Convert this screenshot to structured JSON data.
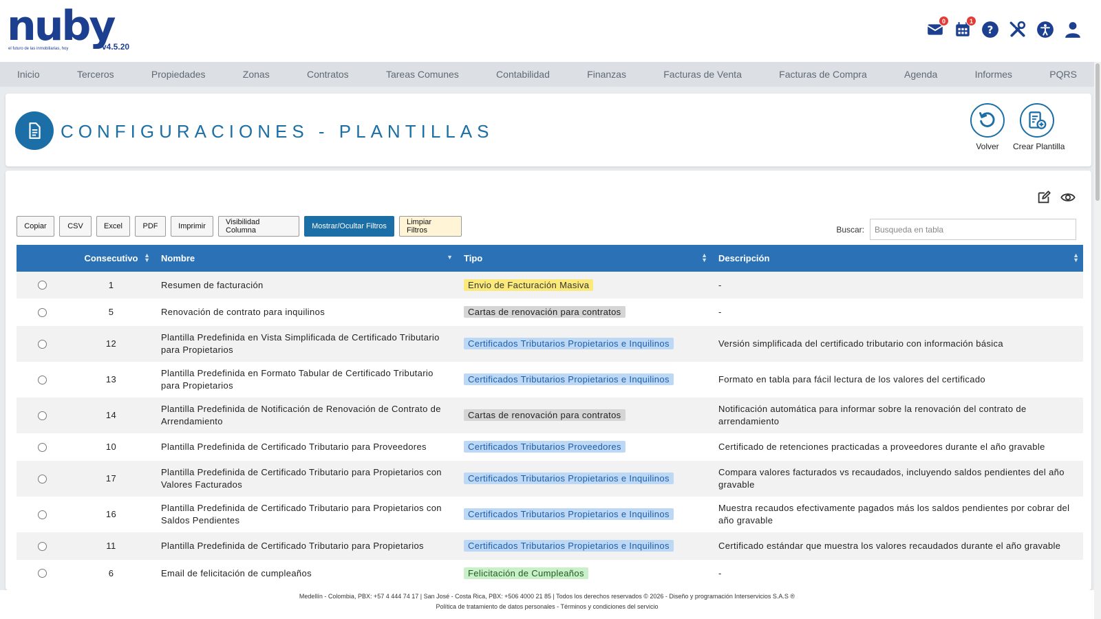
{
  "brand": {
    "name": "nuby",
    "tagline": "el futuro de las inmobiliarias, hoy",
    "version": "v4.5.20",
    "color": "#1d3f8f"
  },
  "header_icons": [
    {
      "name": "mail-icon",
      "badge": "0"
    },
    {
      "name": "calendar-icon",
      "badge": "1"
    },
    {
      "name": "help-icon",
      "badge": ""
    },
    {
      "name": "tools-icon",
      "badge": ""
    },
    {
      "name": "accessibility-icon",
      "badge": ""
    },
    {
      "name": "user-icon",
      "badge": ""
    }
  ],
  "nav": [
    "Inicio",
    "Terceros",
    "Propiedades",
    "Zonas",
    "Contratos",
    "Tareas Comunes",
    "Contabilidad",
    "Finanzas",
    "Facturas de Venta",
    "Facturas de Compra",
    "Agenda",
    "Informes",
    "PQRS"
  ],
  "page": {
    "title": "CONFIGURACIONES - PLANTILLAS",
    "accent": "#1b6fa6",
    "actions": {
      "back": "Volver",
      "create": "Crear Plantilla"
    }
  },
  "toolbar": {
    "buttons": [
      "Copiar",
      "CSV",
      "Excel",
      "PDF",
      "Imprimir",
      "Visibilidad Columna",
      "Mostrar/Ocultar Filtros",
      "Limpiar Filtros"
    ],
    "search_label": "Buscar:",
    "search_placeholder": "Busqueda en tabla"
  },
  "table": {
    "columns": [
      "",
      "Consecutivo",
      "Nombre",
      "Tipo",
      "Descripción"
    ],
    "rows": [
      {
        "id": "1",
        "nombre": "Resumen de facturación",
        "tipo": "Envio de Facturación Masiva",
        "tipo_color": "#fbe97a",
        "tipo_text": "#333333",
        "descripcion": "-"
      },
      {
        "id": "5",
        "nombre": "Renovación de contrato para inquilinos",
        "tipo": "Cartas de renovación para contratos",
        "tipo_color": "#d5d5d5",
        "tipo_text": "#222222",
        "descripcion": "-"
      },
      {
        "id": "12",
        "nombre": "Plantilla Predefinida en Vista Simplificada de Certificado Tributario para Propietarios",
        "tipo": "Certificados Tributarios Propietarios e Inquilinos",
        "tipo_color": "#bcd8f5",
        "tipo_text": "#1e5ea8",
        "descripcion": "Versión simplificada del certificado tributario con información básica"
      },
      {
        "id": "13",
        "nombre": "Plantilla Predefinida en Formato Tabular de Certificado Tributario para Propietarios",
        "tipo": "Certificados Tributarios Propietarios e Inquilinos",
        "tipo_color": "#bcd8f5",
        "tipo_text": "#1e5ea8",
        "descripcion": "Formato en tabla para fácil lectura de los valores del certificado"
      },
      {
        "id": "14",
        "nombre": "Plantilla Predefinida de Notificación de Renovación de Contrato de Arrendamiento",
        "tipo": "Cartas de renovación para contratos",
        "tipo_color": "#d5d5d5",
        "tipo_text": "#222222",
        "descripcion": "Notificación automática para informar sobre la renovación del contrato de arrendamiento"
      },
      {
        "id": "10",
        "nombre": "Plantilla Predefinida de Certificado Tributario para Proveedores",
        "tipo": "Certificados Tributarios Proveedores",
        "tipo_color": "#bcd8f5",
        "tipo_text": "#1e5ea8",
        "descripcion": "Certificado de retenciones practicadas a proveedores durante el año gravable"
      },
      {
        "id": "17",
        "nombre": "Plantilla Predefinida de Certificado Tributario para Propietarios con Valores Facturados",
        "tipo": "Certificados Tributarios Propietarios e Inquilinos",
        "tipo_color": "#bcd8f5",
        "tipo_text": "#1e5ea8",
        "descripcion": "Compara valores facturados vs recaudados, incluyendo saldos pendientes del año gravable"
      },
      {
        "id": "16",
        "nombre": "Plantilla Predefinida de Certificado Tributario para Propietarios con Saldos Pendientes",
        "tipo": "Certificados Tributarios Propietarios e Inquilinos",
        "tipo_color": "#bcd8f5",
        "tipo_text": "#1e5ea8",
        "descripcion": "Muestra recaudos efectivamente pagados más los saldos pendientes por cobrar del año gravable"
      },
      {
        "id": "11",
        "nombre": "Plantilla Predefinida de Certificado Tributario para Propietarios",
        "tipo": "Certificados Tributarios Propietarios e Inquilinos",
        "tipo_color": "#bcd8f5",
        "tipo_text": "#1e5ea8",
        "descripcion": "Certificado estándar que muestra los valores recaudados durante el año gravable"
      },
      {
        "id": "6",
        "nombre": "Email de felicitación de cumpleaños",
        "tipo": "Felicitación de Cumpleaños",
        "tipo_color": "#c9f0c9",
        "tipo_text": "#1f5a1f",
        "descripcion": "-"
      }
    ]
  },
  "footer": {
    "line1": "Medellín - Colombia, PBX: +57 4 444 74 17 | San José - Costa Rica, PBX: +506 4000 21 85 | Todos los derechos reservados © 2026 - Diseño y programación Interservicios S.A.S ®",
    "line2": "Política de tratamiento de datos personales - Términos y condiciones del servicio"
  }
}
